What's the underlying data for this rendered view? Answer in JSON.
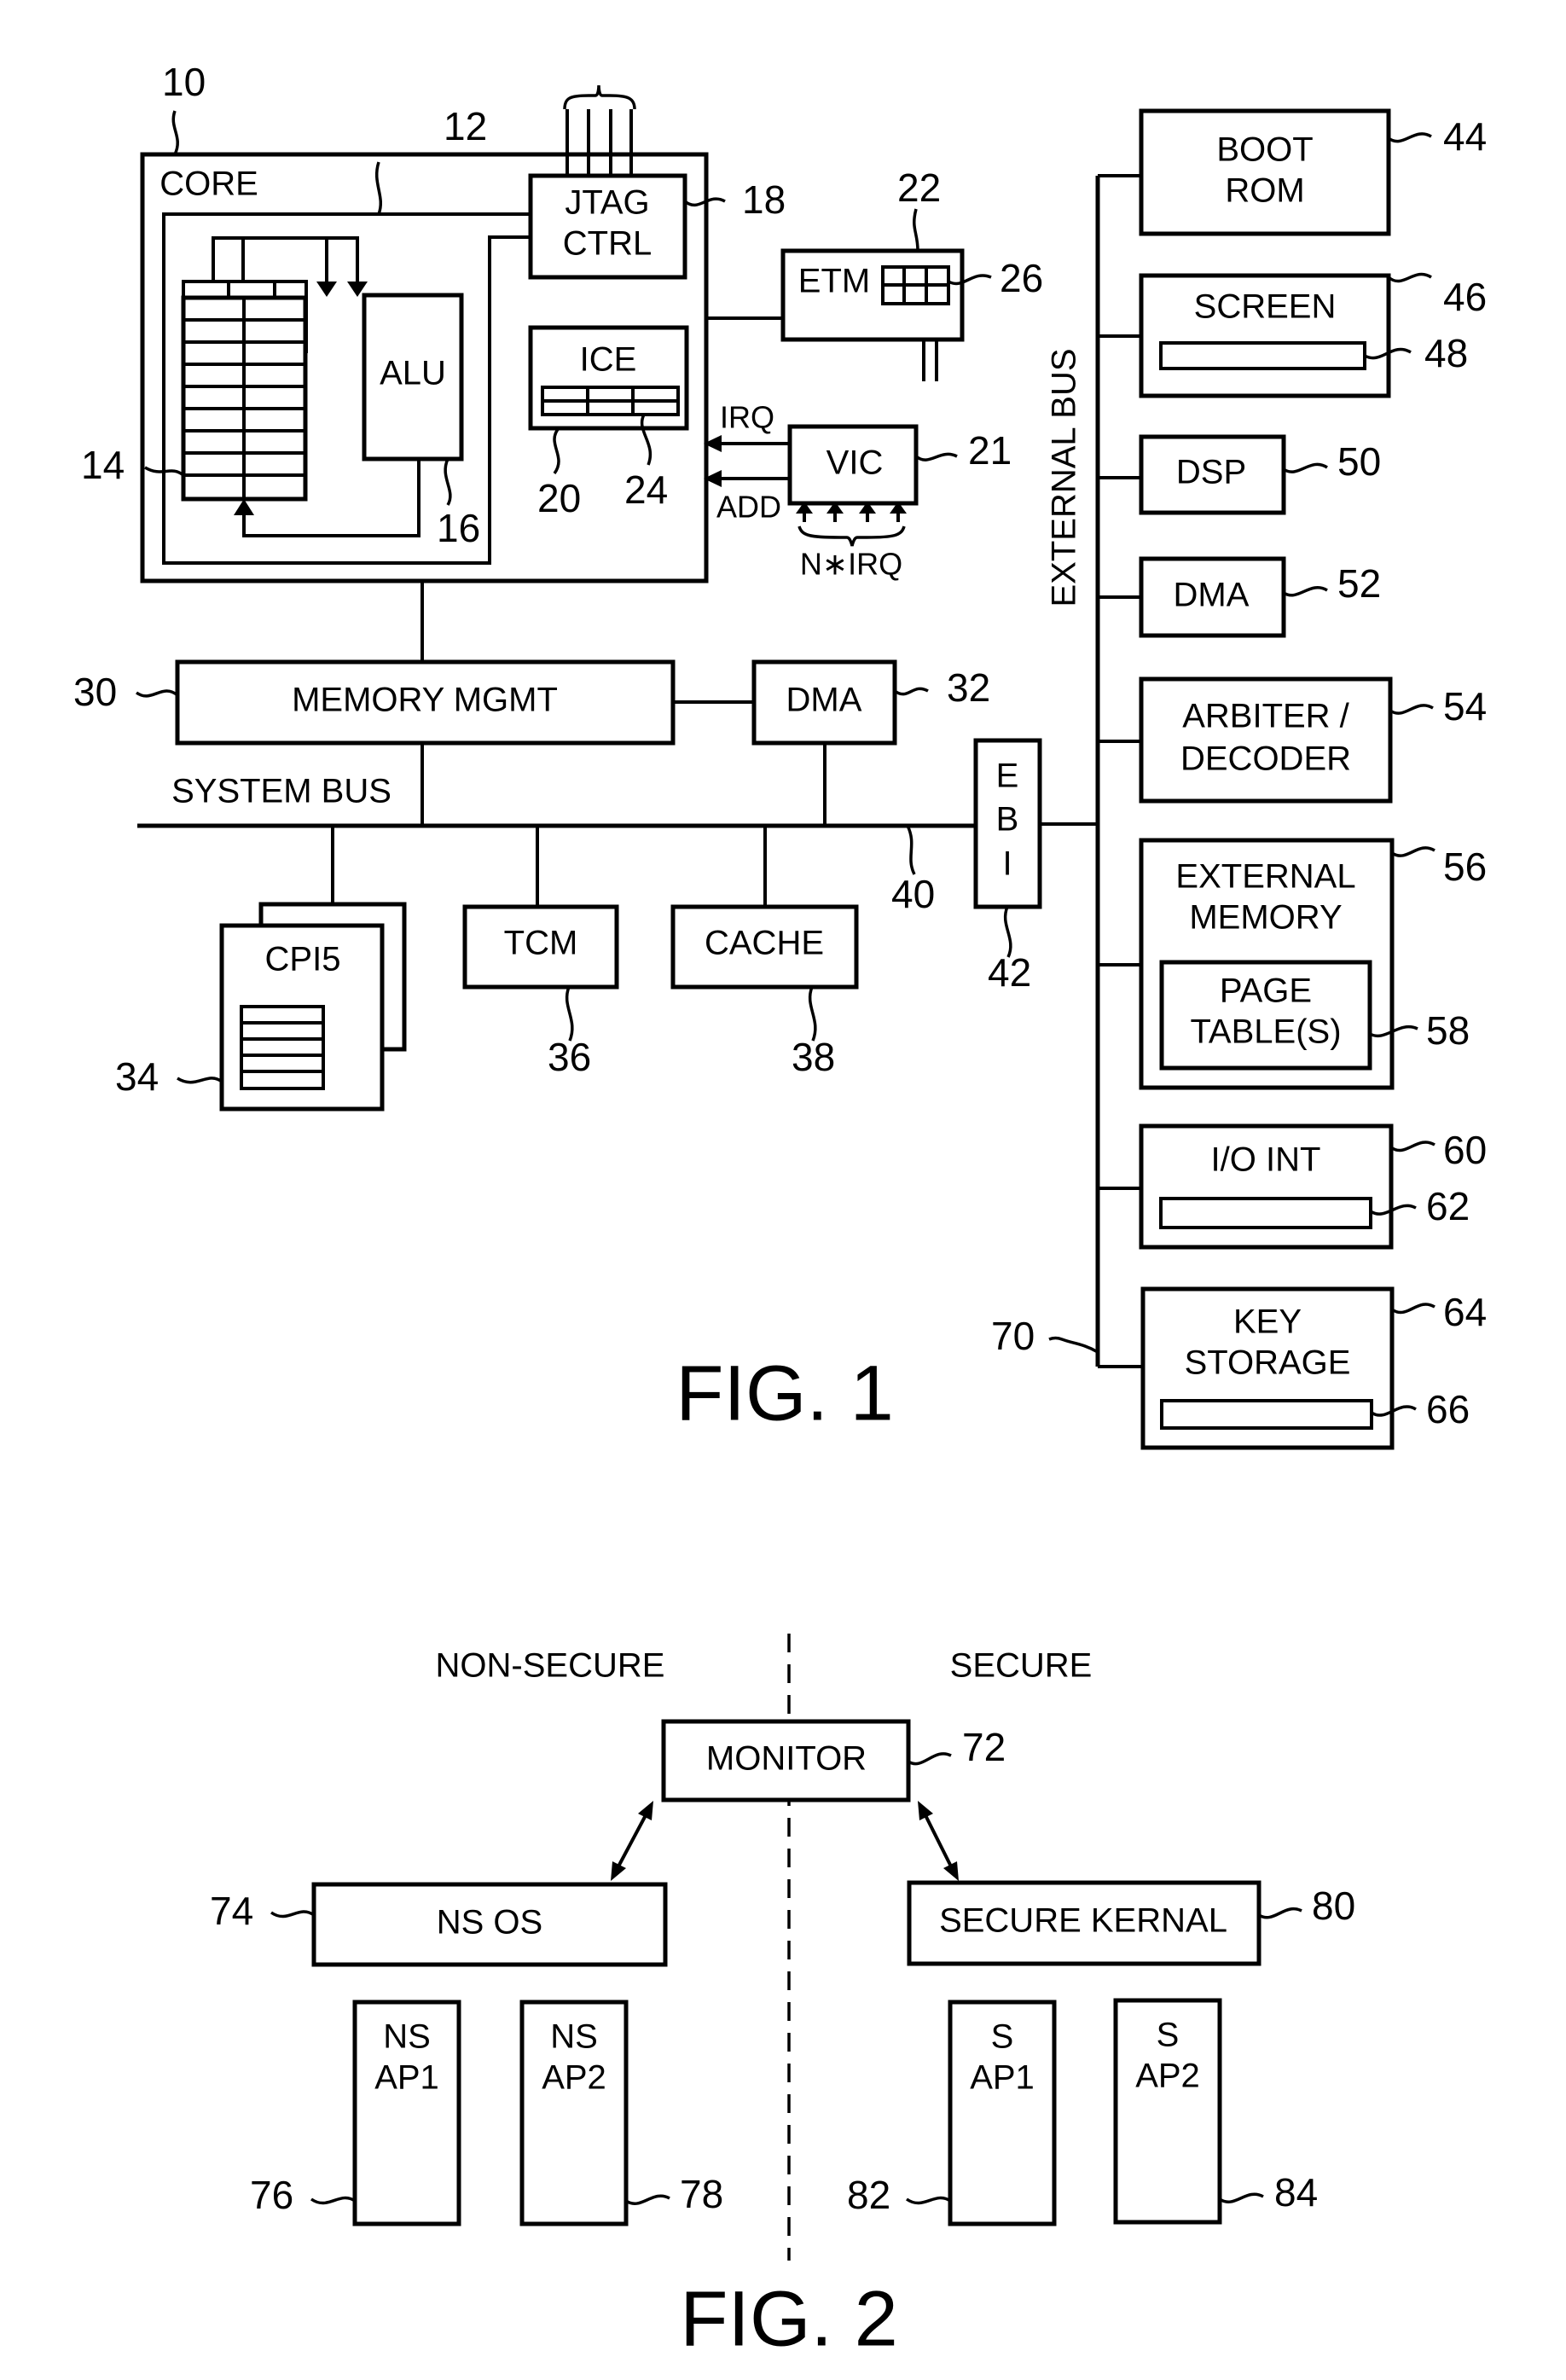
{
  "figure1": {
    "caption": "FIG. 1",
    "core": {
      "label": "CORE",
      "ref": "10",
      "inner_ref": "12"
    },
    "register_file": {
      "ref": "14"
    },
    "alu": {
      "label": "ALU",
      "ref": "16"
    },
    "jtag": {
      "line1": "JTAG",
      "line2": "CTRL",
      "ref": "18"
    },
    "ice": {
      "label": "ICE",
      "ref": "20",
      "register_ref": "24"
    },
    "etm": {
      "label": "ETM",
      "ref": "22",
      "buffer_ref": "26"
    },
    "vic": {
      "label": "VIC",
      "ref": "21",
      "irq_label": "IRQ",
      "add_label": "ADD",
      "inputs_label": "N∗IRQ"
    },
    "memory_mgmt": {
      "label": "MEMORY MGMT",
      "ref": "30"
    },
    "dma_internal": {
      "label": "DMA",
      "ref": "32"
    },
    "system_bus": {
      "label": "SYSTEM BUS",
      "ref": "40"
    },
    "cp15": {
      "label": "CPI5",
      "ref": "34"
    },
    "tcm": {
      "label": "TCM",
      "ref": "36"
    },
    "cache": {
      "label": "CACHE",
      "ref": "38"
    },
    "ebi": {
      "letters": [
        "E",
        "B",
        "I"
      ],
      "ref": "42"
    },
    "external_bus": {
      "label": "EXTERNAL BUS",
      "ref": "70"
    },
    "peripherals": [
      {
        "lines": [
          "BOOT",
          "ROM"
        ],
        "ref": "44"
      },
      {
        "lines": [
          "SCREEN"
        ],
        "ref": "46",
        "inner_ref": "48"
      },
      {
        "lines": [
          "DSP"
        ],
        "ref": "50"
      },
      {
        "lines": [
          "DMA"
        ],
        "ref": "52"
      },
      {
        "lines": [
          "ARBITER /",
          "DECODER"
        ],
        "ref": "54"
      },
      {
        "lines": [
          "EXTERNAL",
          "MEMORY"
        ],
        "ref": "56",
        "inner_lines": [
          "PAGE",
          "TABLE(S)"
        ],
        "inner_ref": "58"
      },
      {
        "lines": [
          "I/O INT"
        ],
        "ref": "60",
        "inner_ref": "62"
      },
      {
        "lines": [
          "KEY",
          "STORAGE"
        ],
        "ref": "64",
        "inner_ref": "66"
      }
    ]
  },
  "figure2": {
    "caption": "FIG. 2",
    "non_secure_label": "NON-SECURE",
    "secure_label": "SECURE",
    "monitor": {
      "label": "MONITOR",
      "ref": "72"
    },
    "ns_os": {
      "label": "NS OS",
      "ref": "74"
    },
    "secure_kernel": {
      "label": "SECURE KERNAL",
      "ref": "80"
    },
    "apps": [
      {
        "line1": "NS",
        "line2": "AP1",
        "ref": "76"
      },
      {
        "line1": "NS",
        "line2": "AP2",
        "ref": "78"
      },
      {
        "line1": "S",
        "line2": "AP1",
        "ref": "82"
      },
      {
        "line1": "S",
        "line2": "AP2",
        "ref": "84"
      }
    ]
  }
}
